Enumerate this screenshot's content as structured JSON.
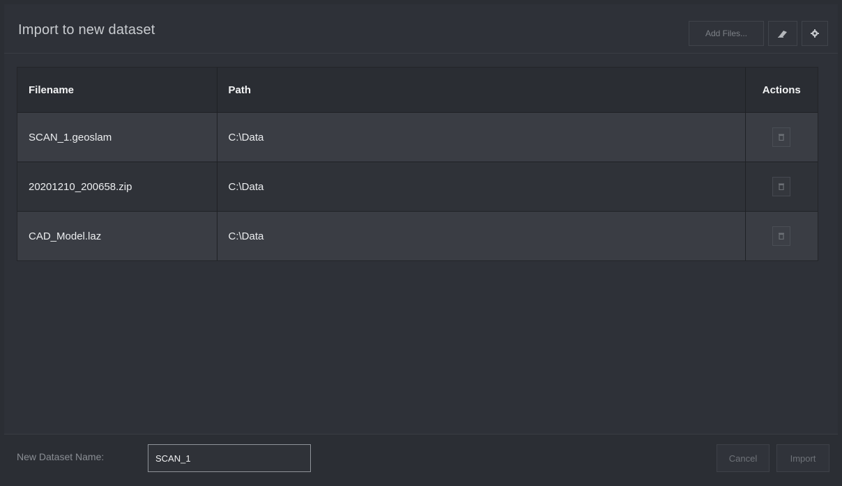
{
  "dialog": {
    "title": "Import to new dataset",
    "add_files_label": "Add Files...",
    "icons": {
      "clear": "eraser-icon",
      "settings": "gear-icon",
      "delete": "trash-icon"
    }
  },
  "table": {
    "headers": {
      "filename": "Filename",
      "path": "Path",
      "actions": "Actions"
    },
    "rows": [
      {
        "filename": "SCAN_1.geoslam",
        "path": "C:\\Data"
      },
      {
        "filename": "20201210_200658.zip",
        "path": "C:\\Data"
      },
      {
        "filename": "CAD_Model.laz",
        "path": "C:\\Data"
      }
    ]
  },
  "footer": {
    "name_label": "New Dataset Name:",
    "name_value": "SCAN_1",
    "cancel_label": "Cancel",
    "import_label": "Import"
  }
}
